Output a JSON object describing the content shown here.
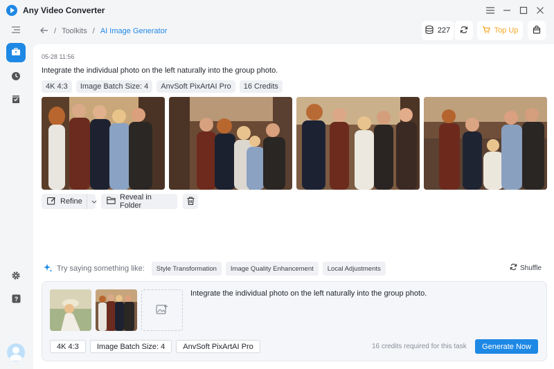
{
  "app": {
    "title": "Any Video Converter",
    "accent": "#1e88e5"
  },
  "window_controls": {
    "menu": "menu-icon",
    "minimize": "minimize-icon",
    "maximize": "maximize-icon",
    "close": "close-icon"
  },
  "sidebar": {
    "items": [
      {
        "name": "sidebar-menu",
        "icon": "hamburger-icon"
      },
      {
        "name": "sidebar-toolkit",
        "icon": "toolbox-icon",
        "active": true
      },
      {
        "name": "sidebar-history",
        "icon": "clock-icon"
      },
      {
        "name": "sidebar-tasks",
        "icon": "checklist-icon"
      },
      {
        "name": "sidebar-settings",
        "icon": "gear-icon"
      },
      {
        "name": "sidebar-help",
        "icon": "help-icon"
      }
    ]
  },
  "breadcrumb": {
    "sep": "/",
    "root": "Toolkits",
    "current": "AI Image Generator"
  },
  "header": {
    "credits_count": "227",
    "top_up": "Top Up",
    "top_up_color": "#f5a623"
  },
  "task": {
    "timestamp": "05-28 11:56",
    "prompt": "Integrate the individual photo on the left naturally into the group photo.",
    "tags": [
      "4K 4:3",
      "Image Batch Size: 4",
      "AnvSoft PixArtAI Pro",
      "16 Credits"
    ]
  },
  "actions": {
    "refine": "Refine",
    "reveal": "Reveal in Folder"
  },
  "suggestions": {
    "label": "Try saying something like:",
    "chips": [
      "Style Transformation",
      "Image Quality Enhancement",
      "Local Adjustments"
    ],
    "shuffle": "Shuffle"
  },
  "composer": {
    "text": "Integrate the individual photo on the left naturally into the group photo.",
    "options": [
      "4K 4:3",
      "Image Batch Size: 4",
      "AnvSoft PixArtAI Pro"
    ],
    "credits_note": "16 credits required for this task",
    "generate": "Generate Now"
  }
}
